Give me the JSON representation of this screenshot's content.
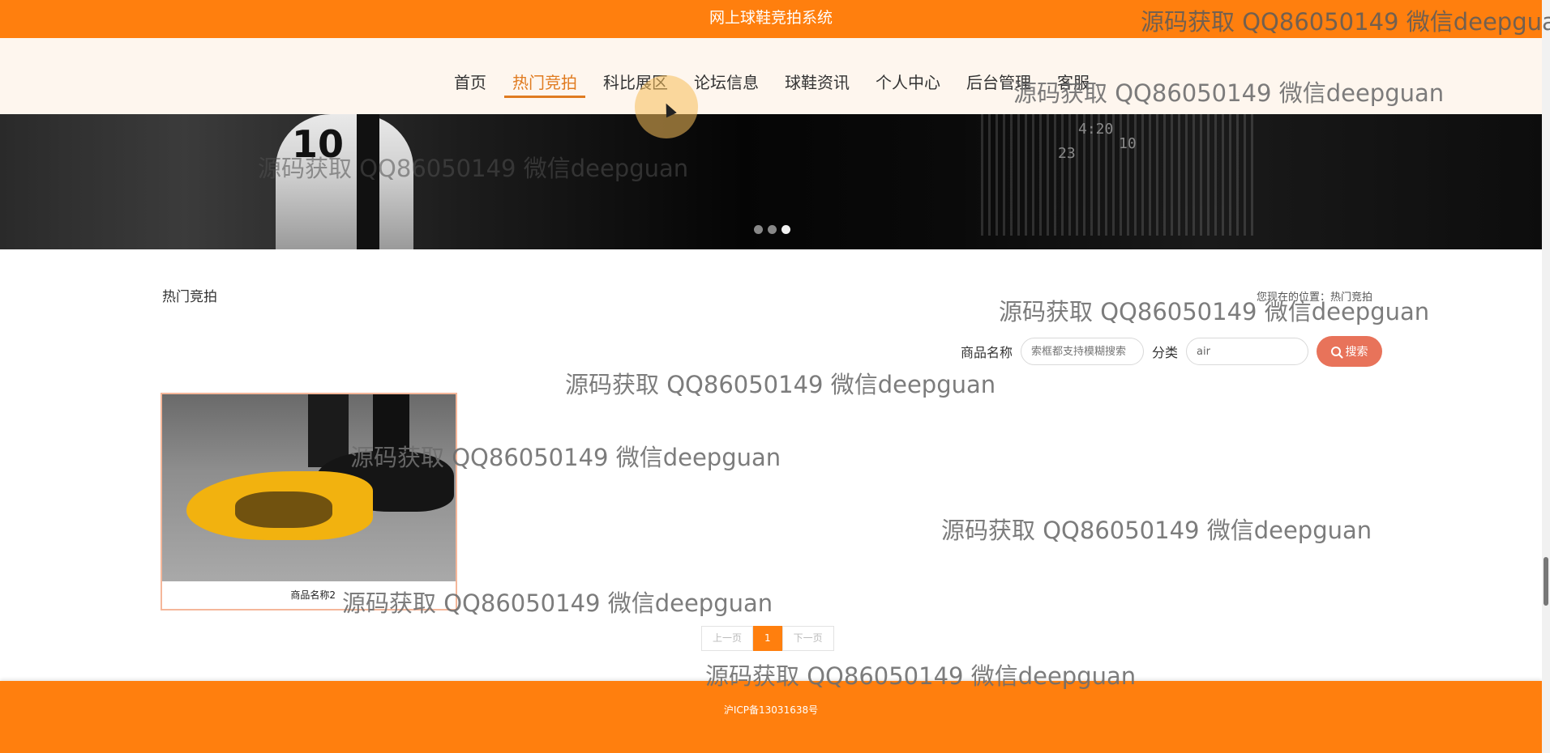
{
  "header": {
    "title": "网上球鞋竞拍系统"
  },
  "nav": {
    "items": [
      {
        "label": "首页"
      },
      {
        "label": "热门竞拍",
        "active": true
      },
      {
        "label": "科比展区"
      },
      {
        "label": "论坛信息"
      },
      {
        "label": "球鞋资讯"
      },
      {
        "label": "个人中心"
      },
      {
        "label": "后台管理"
      },
      {
        "label": "客服"
      }
    ]
  },
  "banner": {
    "jersey_number": "10",
    "scoreboard": [
      "4:20",
      "23",
      "10"
    ],
    "slides": 3,
    "active_slide": 3
  },
  "page": {
    "section_title": "热门竞拍",
    "location": "您现在的位置：热门竞拍"
  },
  "search": {
    "name_label": "商品名称",
    "name_placeholder": "索框都支持模糊搜索",
    "category_label": "分类",
    "category_value": "air",
    "button_label": "搜索"
  },
  "products": [
    {
      "name": "商品名称2"
    }
  ],
  "pagination": {
    "prev": "上一页",
    "current": "1",
    "next": "下一页"
  },
  "footer": {
    "icp": "沪ICP备13031638号"
  },
  "watermark": {
    "text": "源码获取 QQ86050149 微信deepguan",
    "top_text": "源码获取 QQ86050149 微信deepgua"
  },
  "colors": {
    "brand": "#ff7f0e",
    "active_nav": "#e07b20",
    "search_button": "#e8735a",
    "card_border": "#f5b79a"
  }
}
